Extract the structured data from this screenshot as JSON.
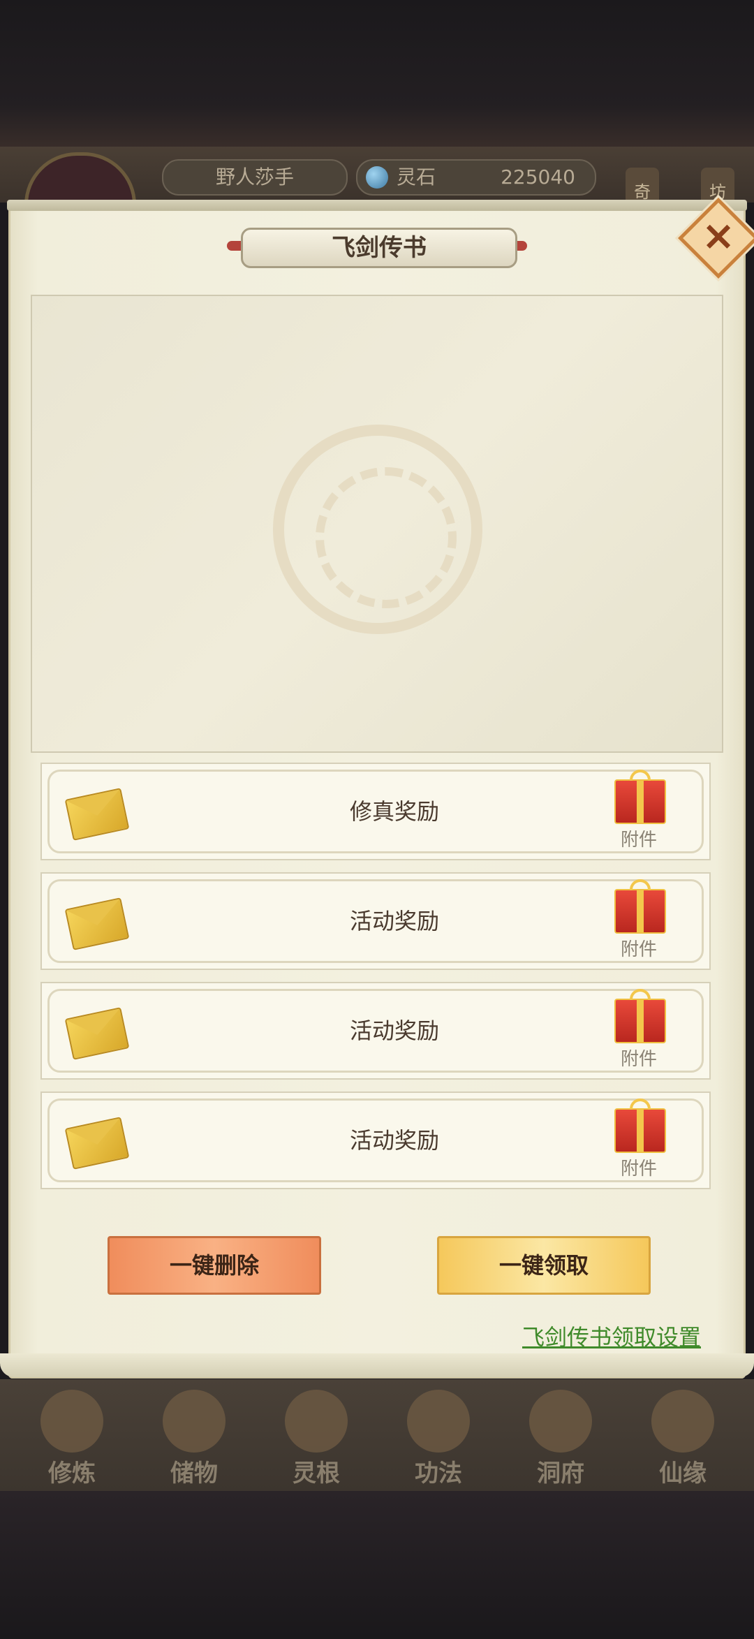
{
  "header": {
    "player_name": "野人莎手",
    "currency_label": "灵石",
    "currency_value": "225040",
    "side_tags": [
      "奇",
      "坊"
    ]
  },
  "dialog": {
    "title": "飞剑传书",
    "close_label": "×",
    "mails": [
      {
        "title": "修真奖励",
        "attachment_label": "附件"
      },
      {
        "title": "活动奖励",
        "attachment_label": "附件"
      },
      {
        "title": "活动奖励",
        "attachment_label": "附件"
      },
      {
        "title": "活动奖励",
        "attachment_label": "附件"
      }
    ],
    "delete_all_label": "一键删除",
    "claim_all_label": "一键领取",
    "settings_link": "飞剑传书领取设置"
  },
  "bottom_nav": {
    "items": [
      {
        "label": "修炼"
      },
      {
        "label": "储物"
      },
      {
        "label": "灵根"
      },
      {
        "label": "功法"
      },
      {
        "label": "洞府"
      },
      {
        "label": "仙缘"
      }
    ]
  },
  "colors": {
    "panel_bg": "#f3f0df",
    "delete_button": "#f08d5c",
    "claim_button": "#f5c85b",
    "link_green": "#3f8a2a"
  }
}
